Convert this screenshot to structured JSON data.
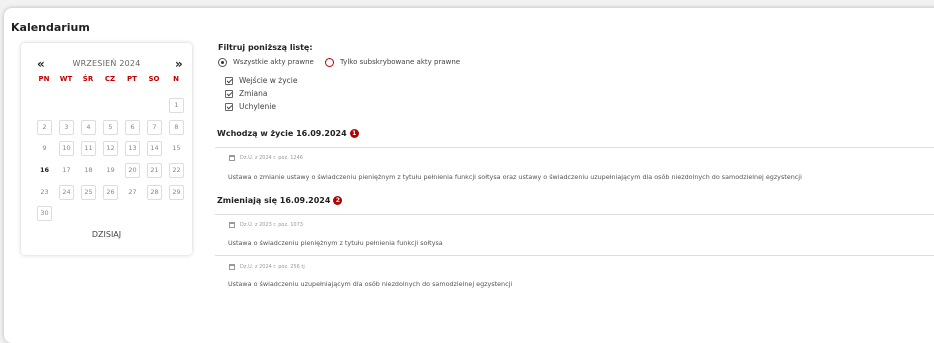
{
  "title": "Kalendarium",
  "calendar": {
    "prev": "«",
    "next": "»",
    "month": "WRZESIEŃ 2024",
    "weekdays": [
      "PN",
      "WT",
      "ŚR",
      "CZ",
      "PT",
      "SO",
      "N"
    ],
    "days": [
      "1",
      "2",
      "3",
      "4",
      "5",
      "6",
      "7",
      "8",
      "9",
      "10",
      "11",
      "12",
      "13",
      "14",
      "15",
      "16",
      "17",
      "18",
      "19",
      "20",
      "21",
      "22",
      "23",
      "24",
      "25",
      "26",
      "27",
      "28",
      "29",
      "30"
    ],
    "today_label": "DZISIAJ",
    "selected_day": "16"
  },
  "filter": {
    "title": "Filtruj poniższą listę:",
    "radio_all": "Wszystkie akty prawne",
    "radio_subscribed": "Tylko subskrybowane akty prawne",
    "checkboxes": [
      "Wejście w życie",
      "Zmiana",
      "Uchylenie"
    ]
  },
  "sections": [
    {
      "title": "Wchodzą w życie 16.09.2024",
      "count": "1",
      "entries": [
        {
          "ref": "Dz.U. z 2024 r. poz. 1246",
          "text": "Ustawa o zmianie ustawy o świadczeniu pieniężnym z tytułu pełnienia funkcji sołtysa oraz ustawy o świadczeniu uzupełniającym dla osób niezdolnych do samodzielnej egzystencji"
        }
      ]
    },
    {
      "title": "Zmieniają się 16.09.2024",
      "count": "2",
      "entries": [
        {
          "ref": "Dz.U. z 2023 r. poz. 1073",
          "text": "Ustawa o świadczeniu pieniężnym z tytułu pełnienia funkcji sołtysa"
        },
        {
          "ref": "Dz.U. z 2024 r. poz. 256 tj",
          "text": "Ustawa o świadczeniu uzupełniającym dla osób niezdolnych do samodzielnej egzystencji"
        }
      ]
    }
  ],
  "colors": {
    "accent": "#b30000",
    "weekday": "#c00000"
  }
}
